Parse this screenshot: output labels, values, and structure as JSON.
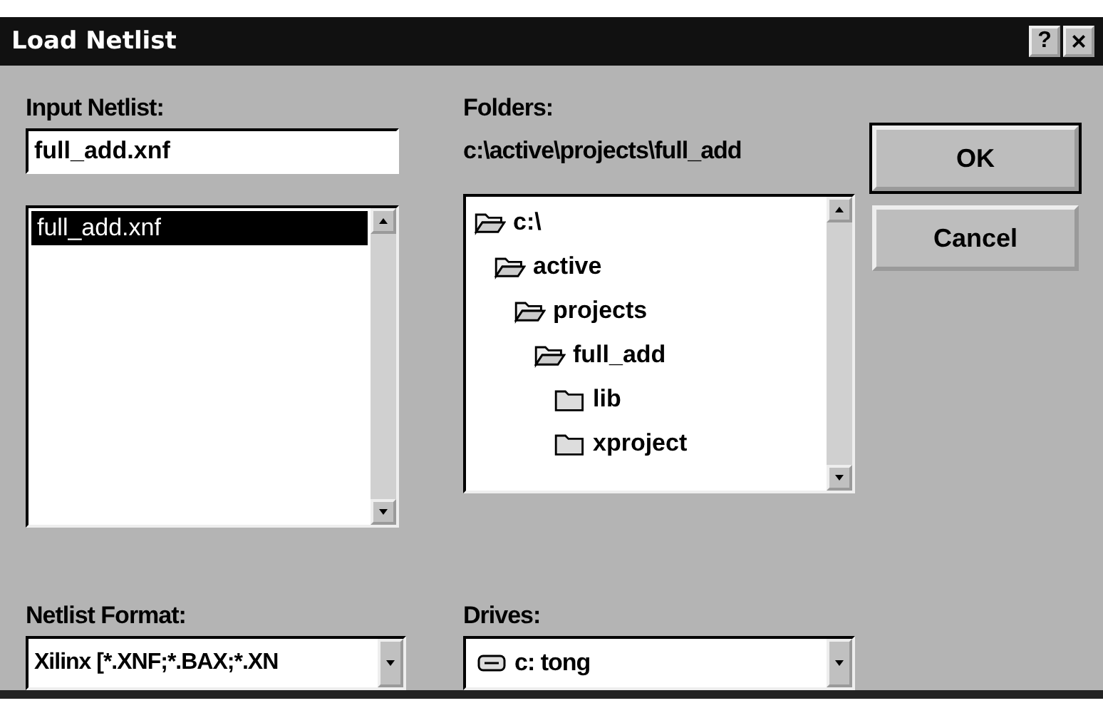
{
  "window": {
    "title": "Load Netlist",
    "title_buttons": [
      {
        "kind": "help",
        "label": "?"
      },
      {
        "kind": "close",
        "label": "×"
      }
    ]
  },
  "input_netlist": {
    "label": "Input Netlist:",
    "value": "full_add.xnf",
    "files": [
      {
        "name": "full_add.xnf",
        "selected": true
      }
    ]
  },
  "folders": {
    "label": "Folders:",
    "path": "c:\\active\\projects\\full_add",
    "tree": [
      {
        "name": "c:\\",
        "open": true,
        "children": [
          {
            "name": "active",
            "open": true,
            "children": [
              {
                "name": "projects",
                "open": true,
                "children": [
                  {
                    "name": "full_add",
                    "open": true,
                    "children": [
                      {
                        "name": "lib",
                        "open": false
                      },
                      {
                        "name": "xproject",
                        "open": false
                      }
                    ]
                  }
                ]
              }
            ]
          }
        ]
      }
    ]
  },
  "buttons": [
    "OK",
    "Cancel"
  ],
  "netlist_format": {
    "label": "Netlist Format:",
    "value": "Xilinx [*.XNF;*.BAX;*.XN"
  },
  "drives": {
    "label": "Drives:",
    "value": "c: tong"
  }
}
